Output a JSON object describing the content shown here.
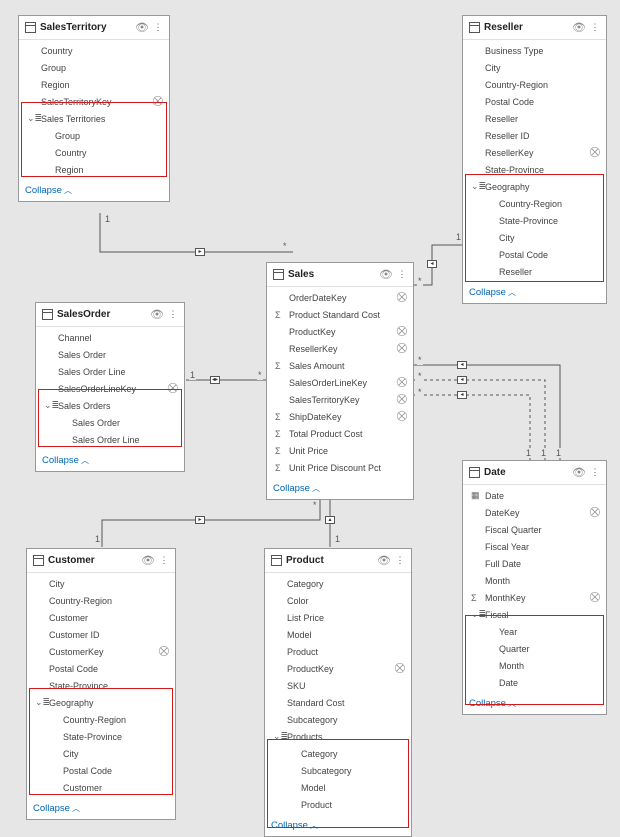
{
  "common": {
    "collapse_label": "Collapse",
    "star": "*",
    "one": "1"
  },
  "tables": {
    "salesTerritory": {
      "title": "SalesTerritory",
      "fields": [
        {
          "label": "Country"
        },
        {
          "label": "Group"
        },
        {
          "label": "Region"
        },
        {
          "label": "SalesTerritoryKey",
          "hidden": true
        },
        {
          "label": "Sales Territories",
          "hier": true
        },
        {
          "label": "Group",
          "indent": 1
        },
        {
          "label": "Country",
          "indent": 1
        },
        {
          "label": "Region",
          "indent": 1
        }
      ]
    },
    "reseller": {
      "title": "Reseller",
      "fields": [
        {
          "label": "Business Type"
        },
        {
          "label": "City"
        },
        {
          "label": "Country-Region"
        },
        {
          "label": "Postal Code"
        },
        {
          "label": "Reseller"
        },
        {
          "label": "Reseller ID"
        },
        {
          "label": "ResellerKey",
          "hidden": true
        },
        {
          "label": "State-Province"
        },
        {
          "label": "Geography",
          "hier": true
        },
        {
          "label": "Country-Region",
          "indent": 1
        },
        {
          "label": "State-Province",
          "indent": 1
        },
        {
          "label": "City",
          "indent": 1
        },
        {
          "label": "Postal Code",
          "indent": 1
        },
        {
          "label": "Reseller",
          "indent": 1
        }
      ]
    },
    "salesOrder": {
      "title": "SalesOrder",
      "fields": [
        {
          "label": "Channel"
        },
        {
          "label": "Sales Order"
        },
        {
          "label": "Sales Order Line"
        },
        {
          "label": "SalesOrderLineKey",
          "hidden": true
        },
        {
          "label": "Sales Orders",
          "hier": true
        },
        {
          "label": "Sales Order",
          "indent": 1
        },
        {
          "label": "Sales Order Line",
          "indent": 1
        }
      ]
    },
    "sales": {
      "title": "Sales",
      "fields": [
        {
          "label": "OrderDateKey",
          "hidden": true
        },
        {
          "label": "Product Standard Cost",
          "sum": true
        },
        {
          "label": "ProductKey",
          "hidden": true
        },
        {
          "label": "ResellerKey",
          "hidden": true
        },
        {
          "label": "Sales Amount",
          "sum": true
        },
        {
          "label": "SalesOrderLineKey",
          "hidden": true
        },
        {
          "label": "SalesTerritoryKey",
          "hidden": true
        },
        {
          "label": "ShipDateKey",
          "sum": true,
          "hidden": true
        },
        {
          "label": "Total Product Cost",
          "sum": true
        },
        {
          "label": "Unit Price",
          "sum": true
        },
        {
          "label": "Unit Price Discount Pct",
          "sum": true
        }
      ]
    },
    "customer": {
      "title": "Customer",
      "fields": [
        {
          "label": "City"
        },
        {
          "label": "Country-Region"
        },
        {
          "label": "Customer"
        },
        {
          "label": "Customer ID"
        },
        {
          "label": "CustomerKey",
          "hidden": true
        },
        {
          "label": "Postal Code"
        },
        {
          "label": "State-Province"
        },
        {
          "label": "Geography",
          "hier": true
        },
        {
          "label": "Country-Region",
          "indent": 1
        },
        {
          "label": "State-Province",
          "indent": 1
        },
        {
          "label": "City",
          "indent": 1
        },
        {
          "label": "Postal Code",
          "indent": 1
        },
        {
          "label": "Customer",
          "indent": 1
        }
      ]
    },
    "product": {
      "title": "Product",
      "fields": [
        {
          "label": "Category"
        },
        {
          "label": "Color"
        },
        {
          "label": "List Price"
        },
        {
          "label": "Model"
        },
        {
          "label": "Product"
        },
        {
          "label": "ProductKey",
          "hidden": true
        },
        {
          "label": "SKU"
        },
        {
          "label": "Standard Cost"
        },
        {
          "label": "Subcategory"
        },
        {
          "label": "Products",
          "hier": true
        },
        {
          "label": "Category",
          "indent": 1
        },
        {
          "label": "Subcategory",
          "indent": 1
        },
        {
          "label": "Model",
          "indent": 1
        },
        {
          "label": "Product",
          "indent": 1
        }
      ]
    },
    "date": {
      "title": "Date",
      "fields": [
        {
          "label": "Date",
          "cal": true
        },
        {
          "label": "DateKey",
          "hidden": true
        },
        {
          "label": "Fiscal Quarter"
        },
        {
          "label": "Fiscal Year"
        },
        {
          "label": "Full Date"
        },
        {
          "label": "Month"
        },
        {
          "label": "MonthKey",
          "sum": true,
          "hidden": true
        },
        {
          "label": "Fiscal",
          "hier": true
        },
        {
          "label": "Year",
          "indent": 1
        },
        {
          "label": "Quarter",
          "indent": 1
        },
        {
          "label": "Month",
          "indent": 1
        },
        {
          "label": "Date",
          "indent": 1
        }
      ]
    }
  }
}
